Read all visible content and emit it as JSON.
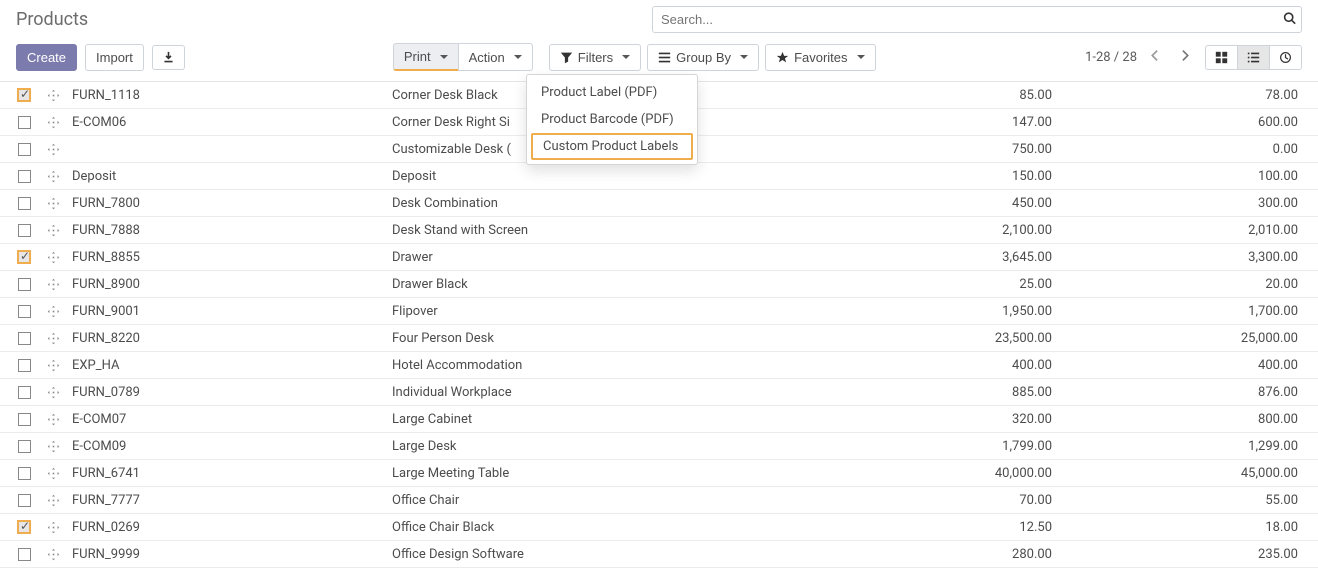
{
  "page": {
    "title": "Products"
  },
  "search": {
    "placeholder": "Search..."
  },
  "toolbar": {
    "create": "Create",
    "import": "Import",
    "print": "Print",
    "action": "Action",
    "filters": "Filters",
    "group_by": "Group By",
    "favorites": "Favorites"
  },
  "print_menu": {
    "items": [
      "Product Label (PDF)",
      "Product Barcode (PDF)",
      "Custom Product Labels"
    ],
    "highlighted_index": 2
  },
  "pager": {
    "text": "1-28 / 28"
  },
  "rows": [
    {
      "checked": true,
      "ref": "FURN_1118",
      "name": "Corner Desk Black",
      "p1": "85.00",
      "p2": "78.00"
    },
    {
      "checked": false,
      "ref": "E-COM06",
      "name": "Corner Desk Right Si",
      "p1": "147.00",
      "p2": "600.00"
    },
    {
      "checked": false,
      "ref": "",
      "name": "Customizable Desk (",
      "p1": "750.00",
      "p2": "0.00"
    },
    {
      "checked": false,
      "ref": "Deposit",
      "name": "Deposit",
      "p1": "150.00",
      "p2": "100.00"
    },
    {
      "checked": false,
      "ref": "FURN_7800",
      "name": "Desk Combination",
      "p1": "450.00",
      "p2": "300.00"
    },
    {
      "checked": false,
      "ref": "FURN_7888",
      "name": "Desk Stand with Screen",
      "p1": "2,100.00",
      "p2": "2,010.00"
    },
    {
      "checked": true,
      "ref": "FURN_8855",
      "name": "Drawer",
      "p1": "3,645.00",
      "p2": "3,300.00"
    },
    {
      "checked": false,
      "ref": "FURN_8900",
      "name": "Drawer Black",
      "p1": "25.00",
      "p2": "20.00"
    },
    {
      "checked": false,
      "ref": "FURN_9001",
      "name": "Flipover",
      "p1": "1,950.00",
      "p2": "1,700.00"
    },
    {
      "checked": false,
      "ref": "FURN_8220",
      "name": "Four Person Desk",
      "p1": "23,500.00",
      "p2": "25,000.00"
    },
    {
      "checked": false,
      "ref": "EXP_HA",
      "name": "Hotel Accommodation",
      "p1": "400.00",
      "p2": "400.00"
    },
    {
      "checked": false,
      "ref": "FURN_0789",
      "name": "Individual Workplace",
      "p1": "885.00",
      "p2": "876.00"
    },
    {
      "checked": false,
      "ref": "E-COM07",
      "name": "Large Cabinet",
      "p1": "320.00",
      "p2": "800.00"
    },
    {
      "checked": false,
      "ref": "E-COM09",
      "name": "Large Desk",
      "p1": "1,799.00",
      "p2": "1,299.00"
    },
    {
      "checked": false,
      "ref": "FURN_6741",
      "name": "Large Meeting Table",
      "p1": "40,000.00",
      "p2": "45,000.00"
    },
    {
      "checked": false,
      "ref": "FURN_7777",
      "name": "Office Chair",
      "p1": "70.00",
      "p2": "55.00"
    },
    {
      "checked": true,
      "ref": "FURN_0269",
      "name": "Office Chair Black",
      "p1": "12.50",
      "p2": "18.00"
    },
    {
      "checked": false,
      "ref": "FURN_9999",
      "name": "Office Design Software",
      "p1": "280.00",
      "p2": "235.00"
    }
  ]
}
